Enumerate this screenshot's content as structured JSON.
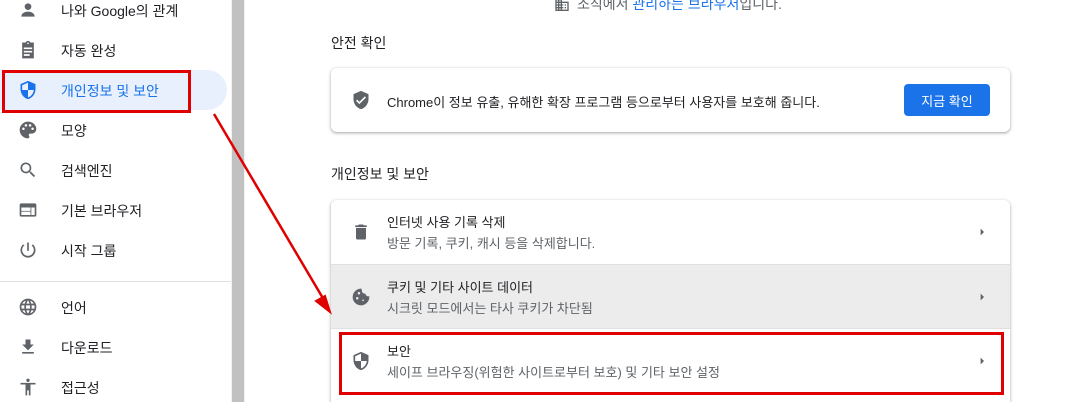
{
  "sidebar": {
    "items": [
      {
        "label": "나와 Google의 관계",
        "icon": "person-icon"
      },
      {
        "label": "자동 완성",
        "icon": "clipboard-icon"
      },
      {
        "label": "개인정보 및 보안",
        "icon": "shield-icon",
        "active": true
      },
      {
        "label": "모양",
        "icon": "palette-icon"
      },
      {
        "label": "검색엔진",
        "icon": "search-icon"
      },
      {
        "label": "기본 브라우저",
        "icon": "browser-icon"
      },
      {
        "label": "시작 그룹",
        "icon": "power-icon"
      },
      {
        "label": "언어",
        "icon": "globe-icon"
      },
      {
        "label": "다운로드",
        "icon": "download-icon"
      },
      {
        "label": "접근성",
        "icon": "accessibility-icon"
      }
    ]
  },
  "main": {
    "managed_note_prefix": "조직에서 ",
    "managed_note_link": "관리하는 브라우저",
    "managed_note_suffix": "입니다.",
    "safety_check": {
      "title": "안전 확인",
      "text": "Chrome이 정보 유출, 유해한 확장 프로그램 등으로부터 사용자를 보호해 줍니다.",
      "button": "지금 확인"
    },
    "privacy": {
      "title": "개인정보 및 보안",
      "rows": [
        {
          "title": "인터넷 사용 기록 삭제",
          "subtitle": "방문 기록, 쿠키, 캐시 등을 삭제합니다.",
          "icon": "trash-icon"
        },
        {
          "title": "쿠키 및 기타 사이트 데이터",
          "subtitle": "시크릿 모드에서는 타사 쿠키가 차단됨",
          "icon": "cookie-icon"
        },
        {
          "title": "보안",
          "subtitle": "세이프 브라우징(위험한 사이트로부터 보호) 및 기타 보안 설정",
          "icon": "security-shield-icon"
        }
      ]
    }
  },
  "colors": {
    "accent": "#1a73e8",
    "annotation": "#e00000",
    "active_bg": "#e8f0fe"
  }
}
